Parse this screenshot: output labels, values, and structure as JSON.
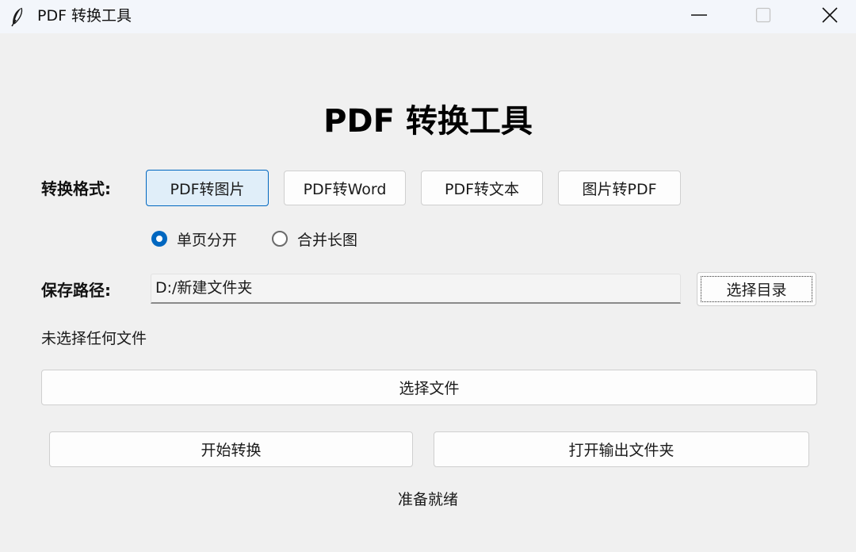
{
  "window": {
    "title": "PDF 转换工具",
    "icons": {
      "app": "feather-icon",
      "minimize": "minimize-icon",
      "maximize": "maximize-icon",
      "close": "close-icon"
    }
  },
  "main": {
    "heading": "PDF 转换工具",
    "format_label": "转换格式:",
    "formats": [
      {
        "label": "PDF转图片",
        "selected": true
      },
      {
        "label": "PDF转Word",
        "selected": false
      },
      {
        "label": "PDF转文本",
        "selected": false
      },
      {
        "label": "图片转PDF",
        "selected": false
      }
    ],
    "image_modes": [
      {
        "label": "单页分开",
        "checked": true
      },
      {
        "label": "合并长图",
        "checked": false
      }
    ],
    "save_path_label": "保存路径:",
    "save_path_value": "D:/新建文件夹",
    "choose_dir_label": "选择目录",
    "file_status": "未选择任何文件",
    "choose_file_label": "选择文件",
    "start_label": "开始转换",
    "open_output_label": "打开输出文件夹",
    "status": "准备就绪"
  },
  "colors": {
    "accent": "#0067c0",
    "background": "#f0f0f0",
    "selected_bg": "#e0eef9"
  }
}
